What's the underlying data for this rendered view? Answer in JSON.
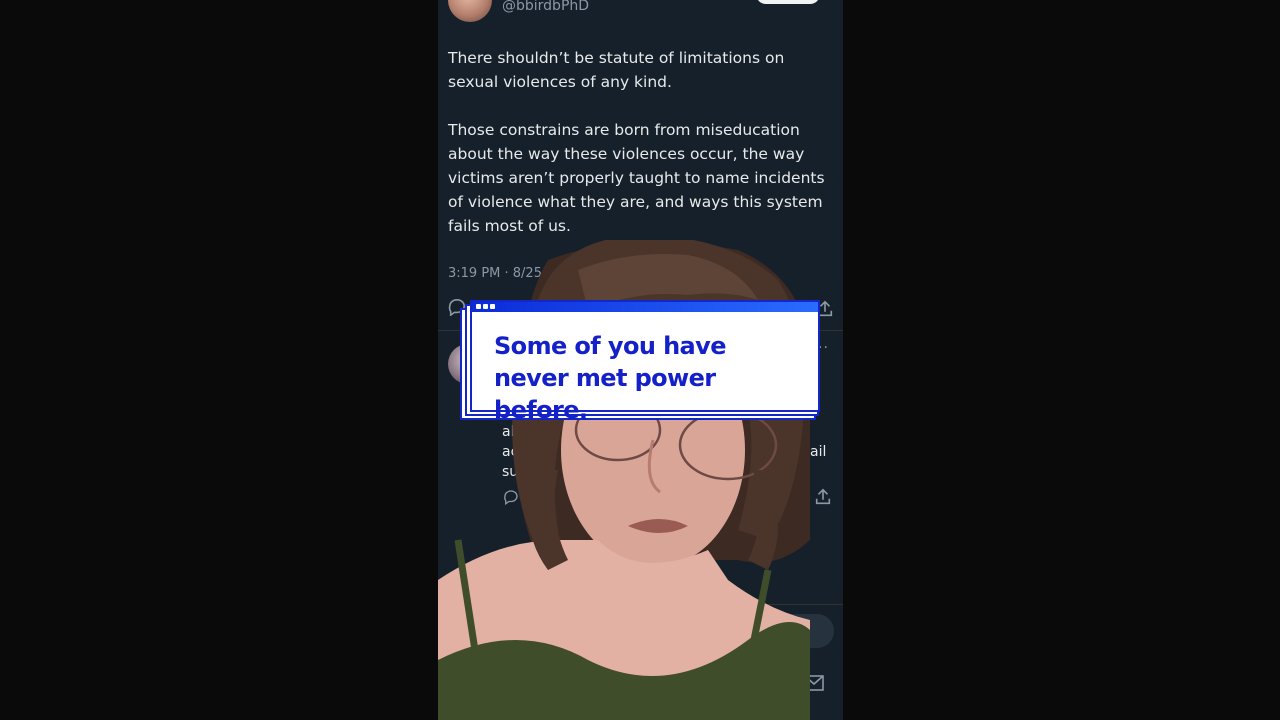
{
  "tweet": {
    "handle": "@bbirdbPhD",
    "paragraphs": [
      "There shouldn’t be statute of limitations on sexual violences of any kind.",
      "Those constrains are born from miseducation about the way these violences occur, the way victims aren’t properly taught to name incidents of violence what they are, and ways this system fails most of us."
    ],
    "timestamp": "3:19 PM · 8/25/25",
    "icons": {
      "reply": "reply-icon",
      "share": "share-icon",
      "more": "more-icon"
    }
  },
  "reply": {
    "visible_fragments": [
      "alw",
      "acc",
      "ail",
      "surv"
    ],
    "icons": {
      "reply": "reply-icon",
      "share": "share-icon"
    }
  },
  "caption": {
    "line1": "Some of you have",
    "line2": "never met power before."
  },
  "colors": {
    "background": "#000000",
    "tweet_bg": "#15202b",
    "text": "#e7e9ea",
    "muted": "#8b98a5",
    "caption_accent": "#1326c8",
    "caption_bar": "#2a6cff"
  }
}
